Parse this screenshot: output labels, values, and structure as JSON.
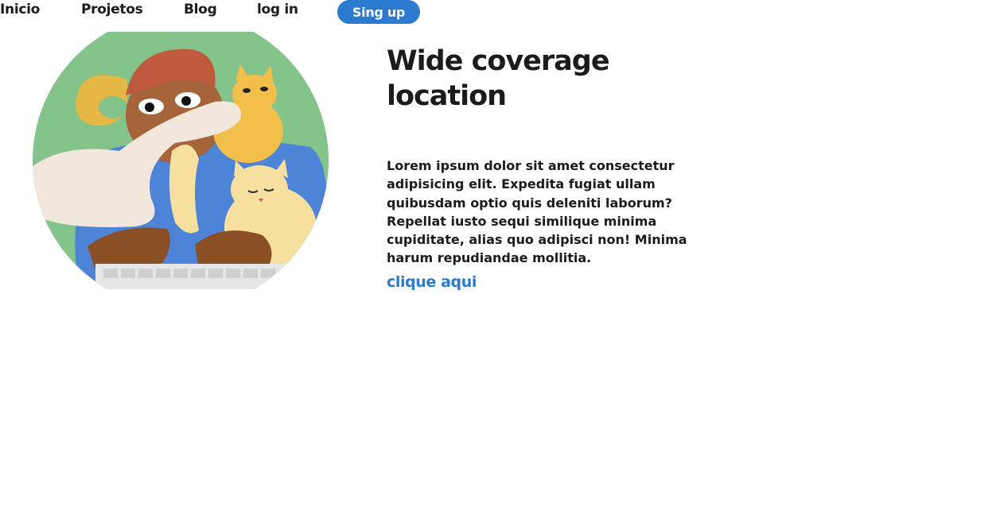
{
  "nav": {
    "items": [
      "Inicio",
      "Projetos",
      "Blog",
      "log in"
    ],
    "signup_label": "Sing up"
  },
  "hero": {
    "title": "Wide coverage location",
    "description": "Lorem ipsum dolor sit amet consectetur adipisicing elit. Expedita fugiat ullam quibusdam optio quis deleniti laborum? Repellat iusto sequi similique minima cupiditate, alias quo adipisci non! Minima harum repudiandae mollitia.",
    "cta_label": "clique aqui",
    "image": "illustration-person-typing-with-cats"
  },
  "colors": {
    "accent": "#2a7bd0",
    "text": "#1b1b1b",
    "illustration_bg": "#84c38a"
  }
}
